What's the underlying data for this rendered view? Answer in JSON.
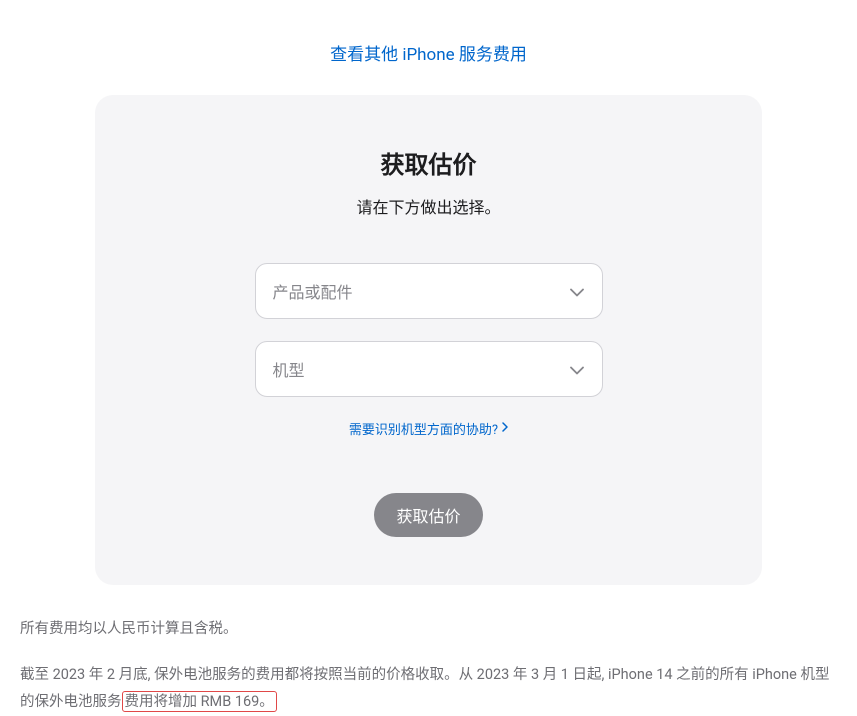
{
  "topLink": {
    "text": "查看其他 iPhone 服务费用"
  },
  "card": {
    "title": "获取估价",
    "subtitle": "请在下方做出选择。",
    "select1": {
      "placeholder": "产品或配件"
    },
    "select2": {
      "placeholder": "机型"
    },
    "helpLink": {
      "text": "需要识别机型方面的协助?"
    },
    "submitButton": {
      "label": "获取估价"
    }
  },
  "footnotes": {
    "line1": "所有费用均以人民币计算且含税。",
    "line2_part1": "截至 2023 年 2 月底, 保外电池服务的费用都将按照当前的价格收取。从 2023 年 3 月 1 日起, iPhone 14 之前的所有 iPhone 机型的保外电池服务",
    "line2_highlight": "费用将增加 RMB 169。"
  }
}
